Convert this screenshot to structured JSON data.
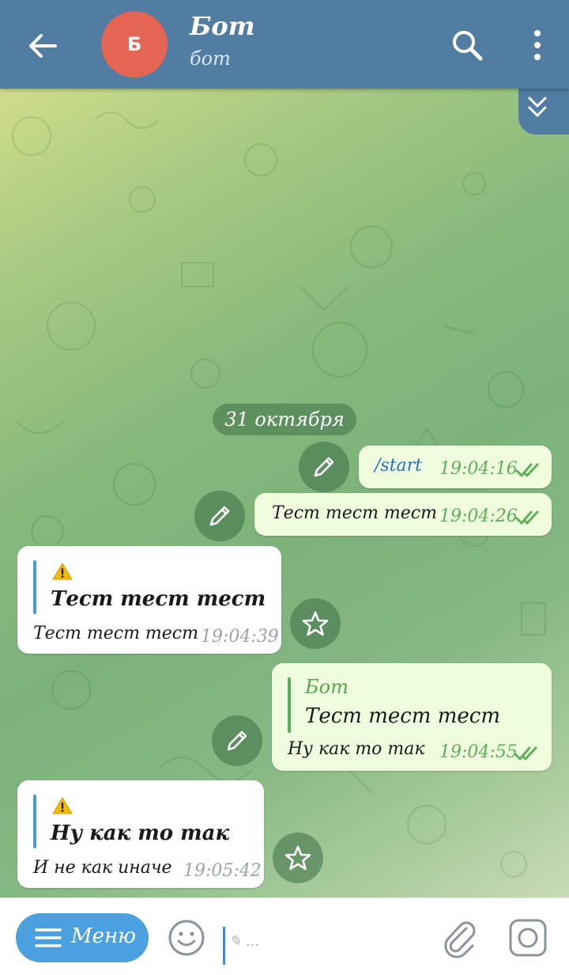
{
  "header": {
    "title": "Бот",
    "subtitle": "бот",
    "avatar_letter": "Б",
    "color": "#517da2"
  },
  "chat": {
    "date": "31 октября",
    "messages": [
      {
        "dir": "out",
        "text": "/start",
        "time": "19:04:16"
      },
      {
        "dir": "out",
        "text": "Тест тест тест",
        "time": "19:04:26"
      },
      {
        "dir": "in",
        "quote_title": "Тест тест тест",
        "text": "Тест тест тест",
        "time": "19:04:39"
      },
      {
        "dir": "out",
        "reply_name": "Бот",
        "reply_text": "Тест тест тест",
        "text": "Ну как то так",
        "time": "19:04:55"
      },
      {
        "dir": "in",
        "quote_title": "Ну как то так",
        "text": "И не как иначе",
        "time": "19:05:42"
      }
    ]
  },
  "input": {
    "menu_label": "Меню",
    "placeholder": "..."
  },
  "colors": {
    "out_bubble": "#effdde",
    "in_bubble": "#ffffff",
    "accent_green": "#5fae5a",
    "accent_blue": "#4ba0e0"
  },
  "icons": [
    "back-arrow-icon",
    "search-icon",
    "more-vert-icon",
    "chevron-double-down-icon",
    "pencil-icon",
    "star-icon",
    "warning-icon",
    "double-check-icon",
    "menu-lines-icon",
    "emoji-icon",
    "attach-icon",
    "camera-icon"
  ]
}
